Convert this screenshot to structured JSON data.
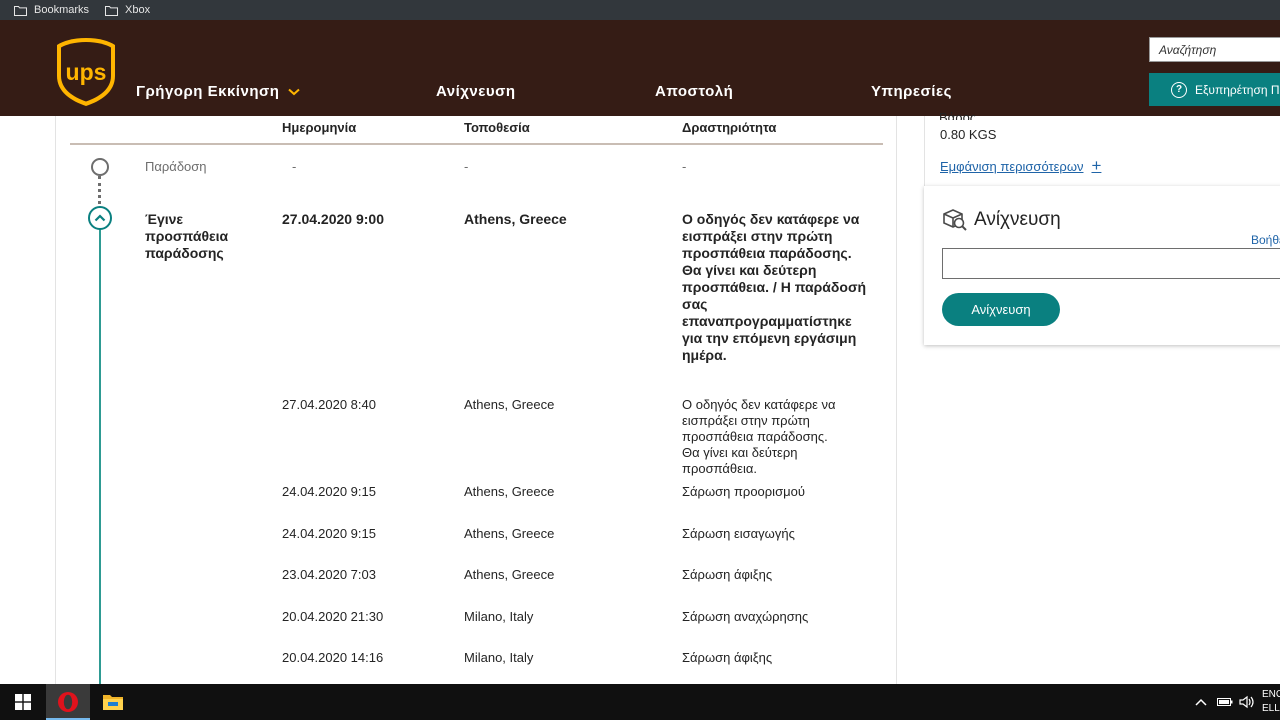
{
  "bookmarks_bar": {
    "items": [
      {
        "label": "Bookmarks",
        "icon": "folder-icon"
      },
      {
        "label": "Xbox",
        "icon": "folder-icon"
      }
    ]
  },
  "header": {
    "logo_text": "ups",
    "nav": [
      {
        "label": "Γρήγορη Εκκίνηση"
      },
      {
        "label": "Ανίχνευση"
      },
      {
        "label": "Αποστολή"
      },
      {
        "label": "Υπηρεσίες"
      }
    ],
    "search_placeholder": "Αναζήτηση",
    "support_label": "Εξυπηρέτηση Πελατών"
  },
  "tracking_table": {
    "columns": [
      "Ημερομηνία",
      "Τοποθεσία",
      "Δραστηριότητα"
    ],
    "pending": {
      "status": "Παράδοση",
      "date": "-",
      "location": "-",
      "activity": "-"
    },
    "current": {
      "status": "Έγινε προσπάθεια παράδοσης",
      "date": "27.04.2020  9:00",
      "location": "Athens, Greece",
      "activity": "Ο οδηγός δεν κατάφερε να εισπράξει στην πρώτη προσπάθεια παράδοσης. Θα γίνει και δεύτερη προσπάθεια. / Η παράδοσή σας επαναπρογραμματίστηκε για την επόμενη εργάσιμη ημέρα."
    },
    "rows": [
      {
        "date": "27.04.2020  8:40",
        "location": "Athens, Greece",
        "activity": "Ο οδηγός δεν κατάφερε να εισπράξει στην πρώτη προσπάθεια παράδοσης. Θα γίνει και δεύτερη προσπάθεια."
      },
      {
        "date": "24.04.2020  9:15",
        "location": "Athens, Greece",
        "activity": "Σάρωση προορισμού"
      },
      {
        "date": "24.04.2020  9:15",
        "location": "Athens, Greece",
        "activity": "Σάρωση εισαγωγής"
      },
      {
        "date": "23.04.2020  7:03",
        "location": "Athens, Greece",
        "activity": "Σάρωση άφιξης"
      },
      {
        "date": "20.04.2020  21:30",
        "location": "Milano, Italy",
        "activity": "Σάρωση αναχώρησης"
      },
      {
        "date": "20.04.2020  14:16",
        "location": "Milano, Italy",
        "activity": "Σάρωση άφιξης"
      }
    ]
  },
  "side": {
    "weight_label": "Βάρος",
    "weight_value": "0.80 KGS",
    "show_more": "Εμφάνιση περισσότερων",
    "track_title": "Ανίχνευση",
    "help_link": "Βοήθεια",
    "track_button": "Ανίχνευση",
    "track_input_value": ""
  },
  "taskbar": {
    "apps": [
      {
        "name": "opera-browser",
        "active": true
      },
      {
        "name": "file-explorer",
        "active": false
      }
    ],
    "lang_line1": "ENG",
    "lang_line2": "ELL"
  },
  "colors": {
    "header_bg": "#351c15",
    "ups_gold": "#ffb500",
    "teal": "#0a8080",
    "link": "#1f64a8"
  }
}
